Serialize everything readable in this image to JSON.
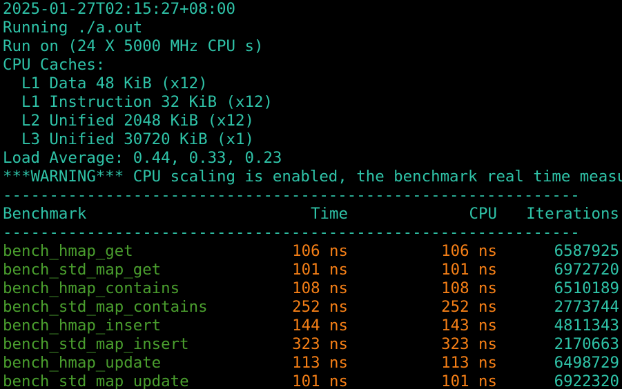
{
  "header": {
    "timestamp": "2025-01-27T02:15:27+08:00",
    "running": "Running ./a.out",
    "run_on": "Run on (24 X 5000 MHz CPU s)",
    "caches_title": "CPU Caches:",
    "caches": [
      "  L1 Data 48 KiB (x12)",
      "  L1 Instruction 32 KiB (x12)",
      "  L2 Unified 2048 KiB (x12)",
      "  L3 Unified 30720 KiB (x1)"
    ],
    "load_average": "Load Average: 0.44, 0.33, 0.23",
    "warning": "***WARNING*** CPU scaling is enabled, the benchmark real time measu"
  },
  "table": {
    "separator": "--------------------------------------------------------------",
    "columns": {
      "benchmark": "Benchmark",
      "time": "Time",
      "cpu": "CPU",
      "iterations": "Iterations"
    },
    "rows": [
      {
        "name": "bench_hmap_get",
        "time": "106 ns",
        "cpu": "106 ns",
        "iterations": "6587925"
      },
      {
        "name": "bench_std_map_get",
        "time": "101 ns",
        "cpu": "101 ns",
        "iterations": "6972720"
      },
      {
        "name": "bench_hmap_contains",
        "time": "108 ns",
        "cpu": "108 ns",
        "iterations": "6510189"
      },
      {
        "name": "bench_std_map_contains",
        "time": "252 ns",
        "cpu": "252 ns",
        "iterations": "2773744"
      },
      {
        "name": "bench_hmap_insert",
        "time": "144 ns",
        "cpu": "143 ns",
        "iterations": "4811343"
      },
      {
        "name": "bench_std_map_insert",
        "time": "323 ns",
        "cpu": "323 ns",
        "iterations": "2170663"
      },
      {
        "name": "bench_hmap_update",
        "time": "113 ns",
        "cpu": "113 ns",
        "iterations": "6498729"
      },
      {
        "name": "bench_std_map_update",
        "time": "101 ns",
        "cpu": "101 ns",
        "iterations": "6922320"
      }
    ]
  },
  "colors": {
    "background": "#000000",
    "text": "#2fc3a8",
    "benchmark_name": "#4a9e2e",
    "timing": "#f57f16"
  }
}
